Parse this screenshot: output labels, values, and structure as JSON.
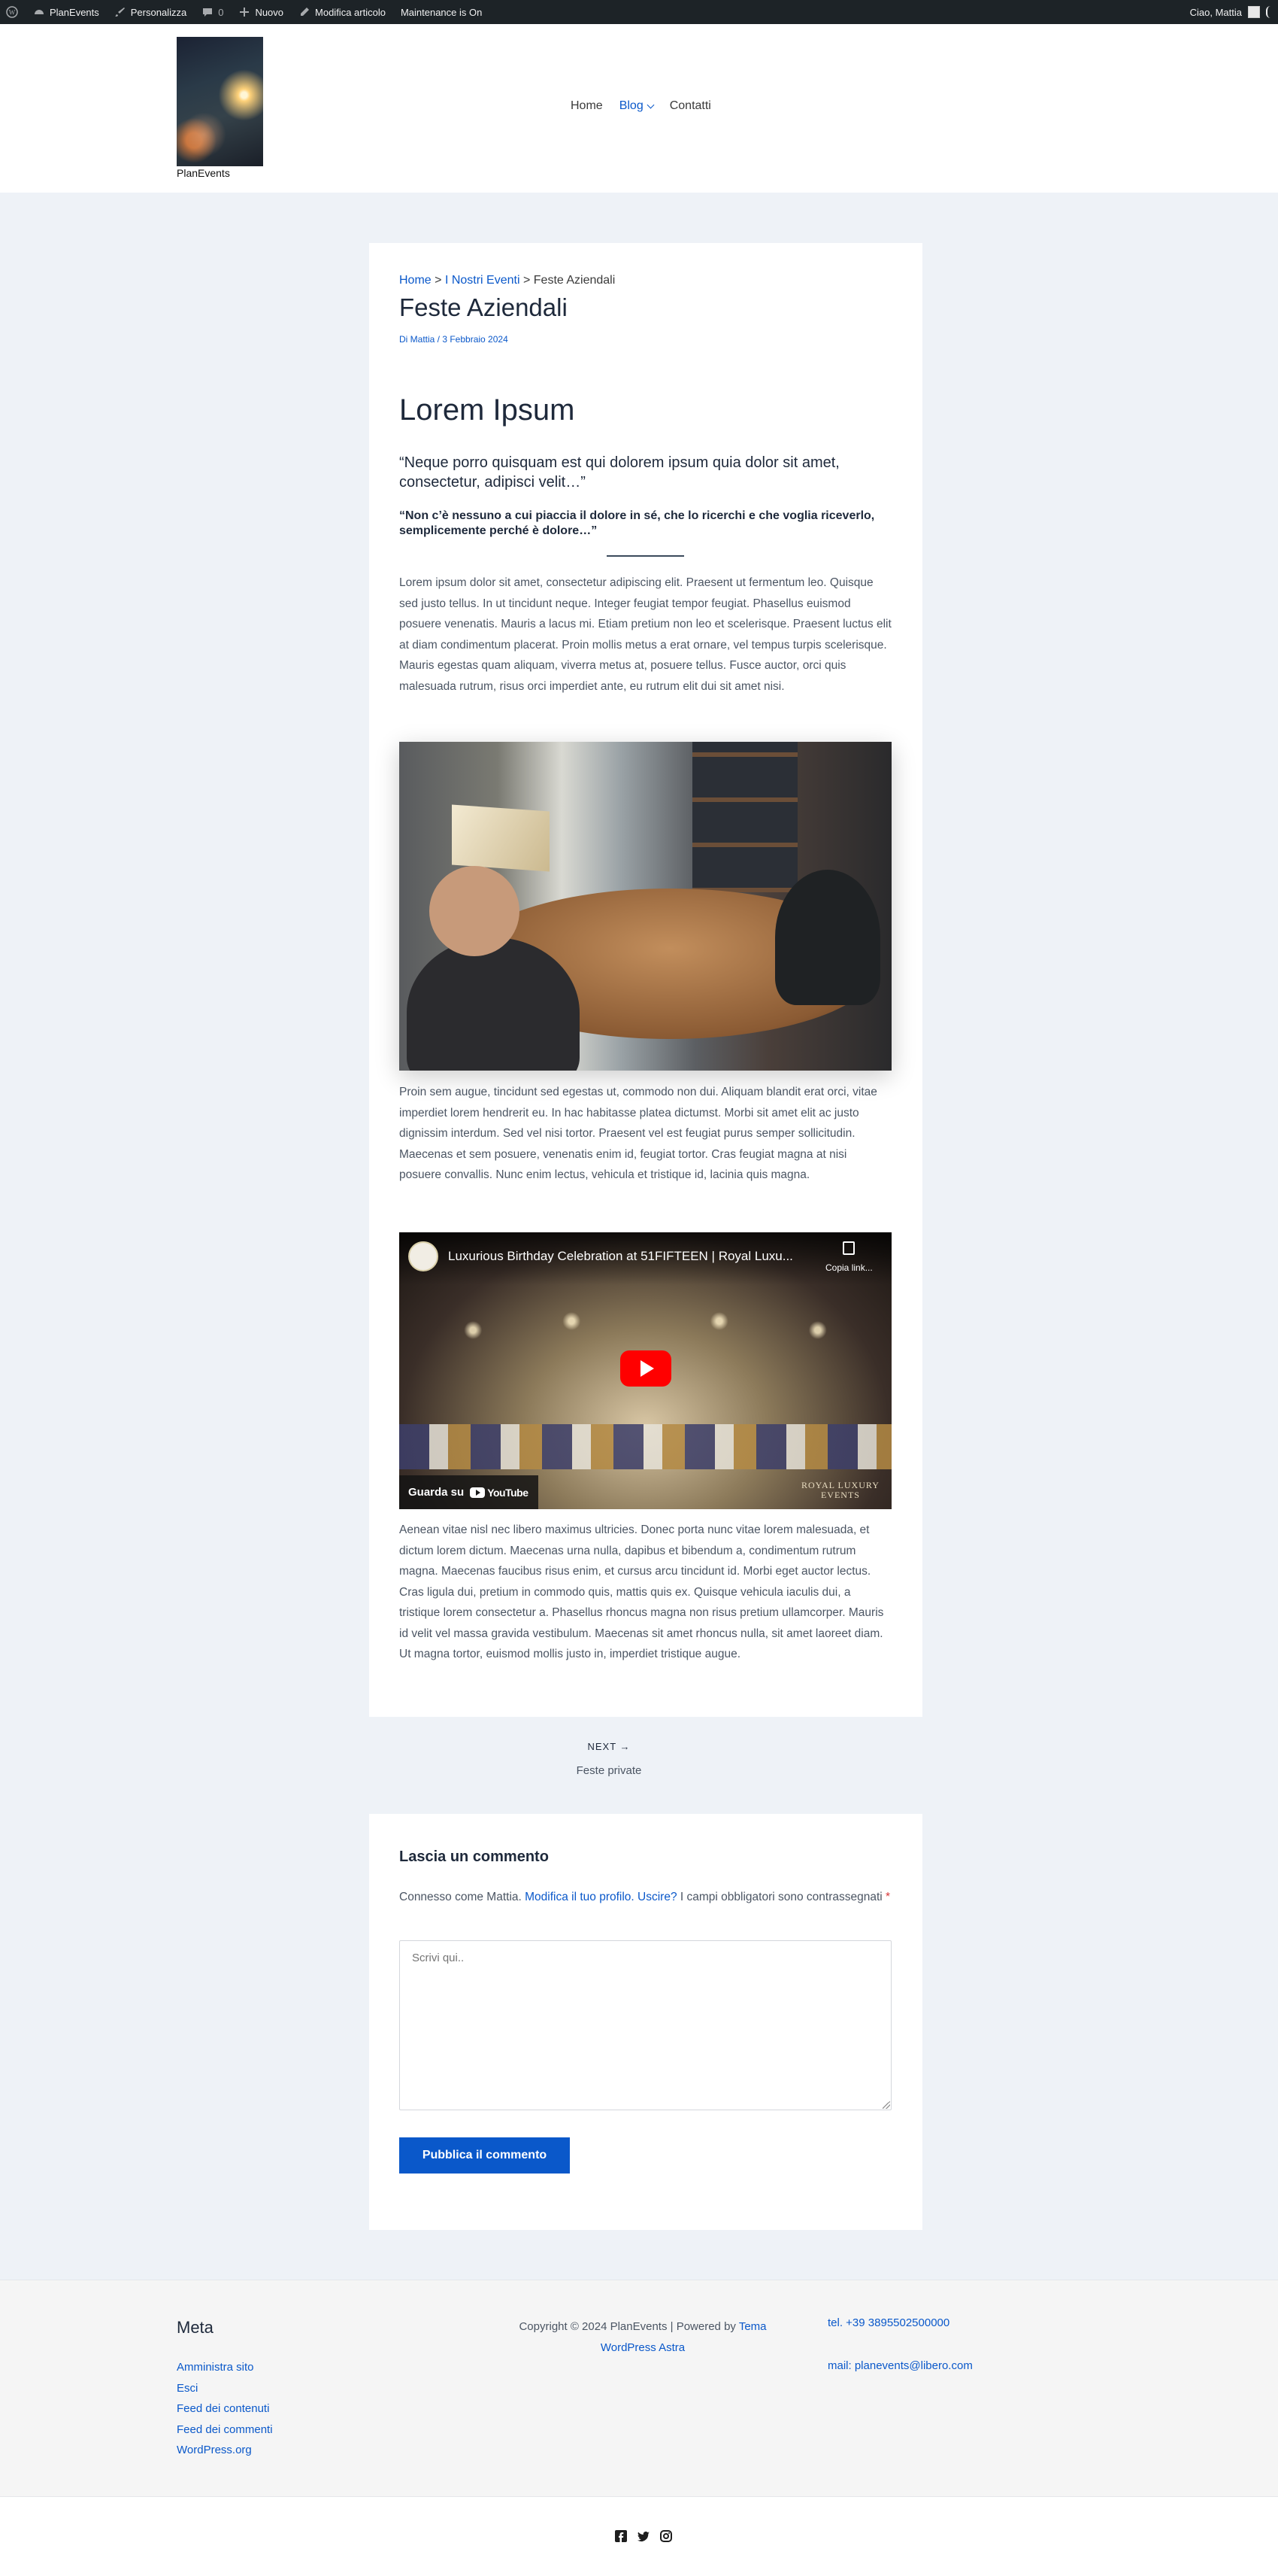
{
  "adminbar": {
    "site_name": "PlanEvents",
    "customize": "Personalizza",
    "comments_count": "0",
    "new": "Nuovo",
    "edit_post": "Modifica articolo",
    "maintenance": "Maintenance is On",
    "greeting": "Ciao, Mattia"
  },
  "header": {
    "site_title": "PlanEvents",
    "nav": [
      {
        "label": "Home"
      },
      {
        "label": "Blog"
      },
      {
        "label": "Contatti"
      }
    ]
  },
  "article": {
    "breadcrumb": {
      "home": "Home",
      "sep": ">",
      "category": "I Nostri Eventi",
      "current": "Feste Aziendali"
    },
    "title": "Feste Aziendali",
    "meta": "Di Mattia / 3 Febbraio 2024",
    "heading": "Lorem Ipsum",
    "quote1": "“Neque porro quisquam est qui dolorem ipsum quia dolor sit amet, consectetur, adipisci velit…”",
    "quote2": "“Non c’è nessuno a cui piaccia il dolore in sé, che lo ricerchi e che voglia riceverlo, semplicemente perché è dolore…”",
    "paragraph1": "Lorem ipsum dolor sit amet, consectetur adipiscing elit. Praesent ut fermentum leo. Quisque sed justo tellus. In ut tincidunt neque. Integer feugiat tempor feugiat. Phasellus euismod posuere venenatis. Mauris a lacus mi. Etiam pretium non leo et scelerisque. Praesent luctus elit at diam condimentum placerat. Proin mollis metus a erat ornare, vel tempus turpis scelerisque. Mauris egestas quam aliquam, viverra metus at, posuere tellus. Fusce auctor, orci quis malesuada rutrum, risus orci imperdiet ante, eu rutrum elit dui sit amet nisi.",
    "paragraph2": "Proin sem augue, tincidunt sed egestas ut, commodo non dui. Aliquam blandit erat orci, vitae imperdiet lorem hendrerit eu. In hac habitasse platea dictumst. Morbi sit amet elit ac justo dignissim interdum. Sed vel nisi tortor. Praesent vel est feugiat purus semper sollicitudin. Maecenas et sem posuere, venenatis enim id, feugiat tortor. Cras feugiat magna at nisi posuere convallis. Nunc enim lectus, vehicula et tristique id, lacinia quis magna.",
    "paragraph3": "Aenean vitae nisl nec libero maximus ultricies. Donec porta nunc vitae lorem malesuada, et dictum lorem dictum. Maecenas urna nulla, dapibus et bibendum a, condimentum rutrum magna. Maecenas faucibus risus enim, et cursus arcu tincidunt id. Morbi eget auctor lectus. Cras ligula dui, pretium in commodo quis, mattis quis ex. Quisque vehicula iaculis dui, a tristique lorem consectetur a. Phasellus rhoncus magna non risus pretium ullamcorper. Mauris id velit vel massa gravida vestibulum. Maecenas sit amet rhoncus nulla, sit amet laoreet diam. Ut magna tortor, euismod mollis justo in, imperdiet tristique augue.",
    "video": {
      "title": "Luxurious Birthday Celebration at 51FIFTEEN | Royal Luxu...",
      "copy_link": "Copia link...",
      "watch_on": "Guarda su",
      "platform": "YouTube",
      "brand_line1": "ROYAL LUXURY",
      "brand_line2": "EVENTS"
    }
  },
  "post_nav": {
    "label": "NEXT →",
    "title": "Feste private"
  },
  "comments": {
    "heading": "Lascia un commento",
    "logged_prefix": "Connesso come Mattia.",
    "edit_profile": "Modifica il tuo profilo.",
    "logout": "Uscire?",
    "required_note": "I campi obbligatori sono contrassegnati",
    "required_mark": "*",
    "placeholder": "Scrivi qui..",
    "submit": "Pubblica il commento"
  },
  "footer": {
    "meta_title": "Meta",
    "links": [
      "Amministra sito",
      "Esci",
      "Feed dei contenuti",
      "Feed dei commenti",
      "WordPress.org"
    ],
    "copyright": "Copyright © 2024 PlanEvents | Powered by",
    "theme_link": "Tema WordPress Astra",
    "phone": "tel. +39 3895502500000",
    "mail": "mail: planevents@libero.com",
    "social_icons": [
      "facebook-icon",
      "twitter-icon",
      "instagram-icon"
    ]
  },
  "colors": {
    "accent": "#0a58ca",
    "adminbar": "#1d2327",
    "page_bg": "#eef2f7"
  }
}
